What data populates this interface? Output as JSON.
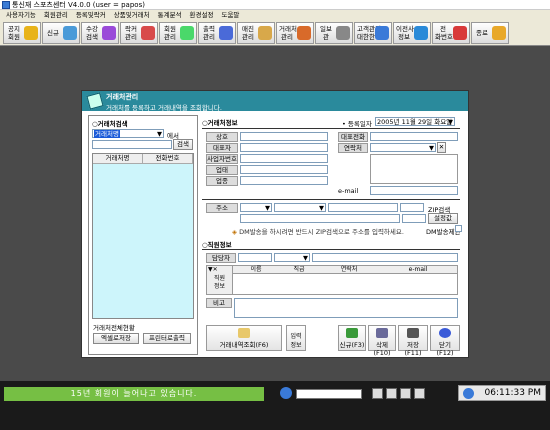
{
  "app": {
    "title": "통신재 스포츠센터 V4.0.0 (user = papos)"
  },
  "menu": [
    "사용자기능",
    "회원관리",
    "등록및락커",
    "상품및거래처",
    "통계분석",
    "환경설정",
    "도움말"
  ],
  "toolbar": [
    {
      "label": "공지\n회원",
      "color": "#e8b31a"
    },
    {
      "label": "신규",
      "color": "#4a9ad8"
    },
    {
      "label": "수강\n검색",
      "color": "#9a4ad8"
    },
    {
      "label": "락커\n관리",
      "color": "#d84a4a"
    },
    {
      "label": "회원\n관리",
      "color": "#4ad86a"
    },
    {
      "label": "출력\n관리",
      "color": "#4a6ad8"
    },
    {
      "label": "매진\n관리",
      "color": "#d8a84a"
    },
    {
      "label": "거래처\n관리",
      "color": "#d86a2a"
    },
    {
      "label": "일보\n관",
      "color": "#888888"
    },
    {
      "label": "고객관리\n대한한",
      "color": "#3a7ad8"
    },
    {
      "label": "이전사\n정보",
      "color": "#2a8ad8"
    },
    {
      "label": "전\n화번호",
      "color": "#d83a3a"
    },
    {
      "label": "종료",
      "color": "#e8a82a"
    }
  ],
  "window": {
    "title": "거래처관리",
    "subtitle": "거래처를 등록하고 거래내역을 조회합니다.",
    "left": {
      "section_title": "거래처검색",
      "search_type": "거래처명",
      "search_suffix": "에서",
      "search_button": "검색",
      "columns": [
        "거래처명",
        "전화번호"
      ],
      "summary_title": "거래처전체현황",
      "excel_button": "엑셀로저장",
      "print_button": "프린터로출력"
    },
    "info": {
      "section_title": "거래처정보",
      "reg_label": "• 등록일자",
      "reg_date": "2005년 11월 29일 화요일",
      "fields": [
        "상호",
        "대표자",
        "사업자번호",
        "업태",
        "업종"
      ],
      "right_fields": [
        "대표전화",
        "연락처"
      ],
      "email_label": "e-mail",
      "address_label": "주소",
      "zip_label": "ZIP검색",
      "clear_label": "설정값",
      "dm_notice": "DM발송을 하시려면 반드시 ZIP검색으로 주소를 입력하세요.",
      "dm_label": "DM발송제한"
    },
    "staff": {
      "section_title": "직원정보",
      "manager_label": "담당자",
      "columns": [
        "이름",
        "직급",
        "연락처",
        "e-mail"
      ],
      "side_label": "직원\n정보",
      "note_label": "비고"
    },
    "buttons": {
      "history": "거래내역조회(F6)",
      "side": "입력\n정보",
      "new": "신규(F3)",
      "delete": "삭제(F10)",
      "save": "저장(F11)",
      "close": "닫기(F12)"
    }
  },
  "status": {
    "message": "15년 회원이 늘어나고 있습니다.",
    "time": "06:11:33 PM"
  }
}
